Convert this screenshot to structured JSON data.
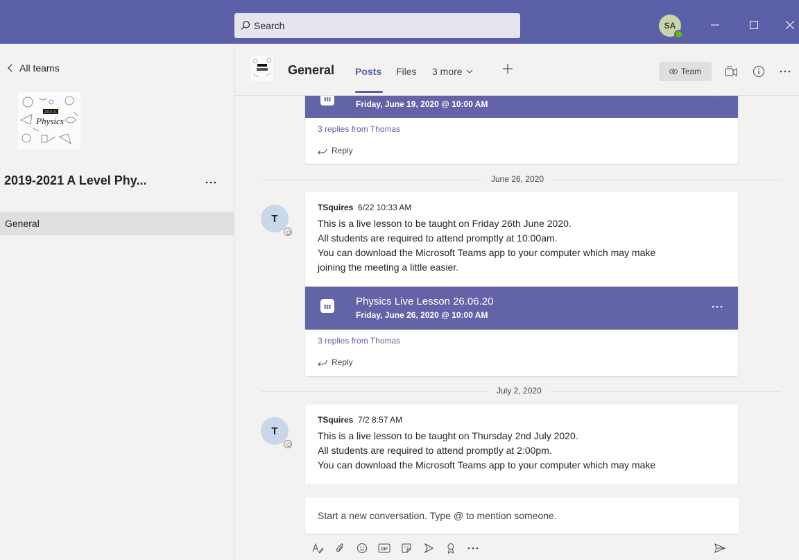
{
  "titlebar": {
    "search_placeholder": "Search",
    "user_initials": "SA"
  },
  "sidebar": {
    "back_label": "All teams",
    "team_name": "2019-2021 A Level Phy...",
    "team_logo_text": "Physics",
    "team_logo_year": "2019-21",
    "channels": [
      {
        "label": "General"
      }
    ]
  },
  "header": {
    "channel_name": "General",
    "tabs": [
      {
        "label": "Posts"
      },
      {
        "label": "Files"
      },
      {
        "label": "3 more"
      }
    ],
    "team_button": "Team"
  },
  "messages": [
    {
      "meeting_date": "Friday, June 19, 2020 @ 10:00 AM",
      "replies": "3 replies from Thomas",
      "reply_label": "Reply"
    },
    {
      "day_divider": "June 26, 2020",
      "avatar_initial": "T",
      "author": "TSquires",
      "time": "6/22 10:33 AM",
      "lines": [
        "This is a live lesson to be taught on Friday 26th June 2020.",
        "All students are required to attend promptly at 10:00am.",
        "You can download the Microsoft Teams app to your computer which may make",
        "joining the meeting a little easier."
      ],
      "meeting_title": "Physics Live Lesson 26.06.20",
      "meeting_date": "Friday, June 26, 2020 @ 10:00 AM",
      "replies": "3 replies from Thomas",
      "reply_label": "Reply"
    },
    {
      "day_divider": "July 2, 2020",
      "avatar_initial": "T",
      "author": "TSquires",
      "time": "7/2 8:57 AM",
      "lines": [
        "This is a live lesson to be taught on Thursday 2nd July 2020.",
        "All students are required to attend promptly at 2:00pm.",
        "You can download the Microsoft Teams app to your computer which may make"
      ]
    }
  ],
  "compose": {
    "placeholder": "Start a new conversation. Type @ to mention someone."
  },
  "colors": {
    "brand": "#5b5fa7",
    "meeting": "#6264a7",
    "link": "#6264a7"
  }
}
